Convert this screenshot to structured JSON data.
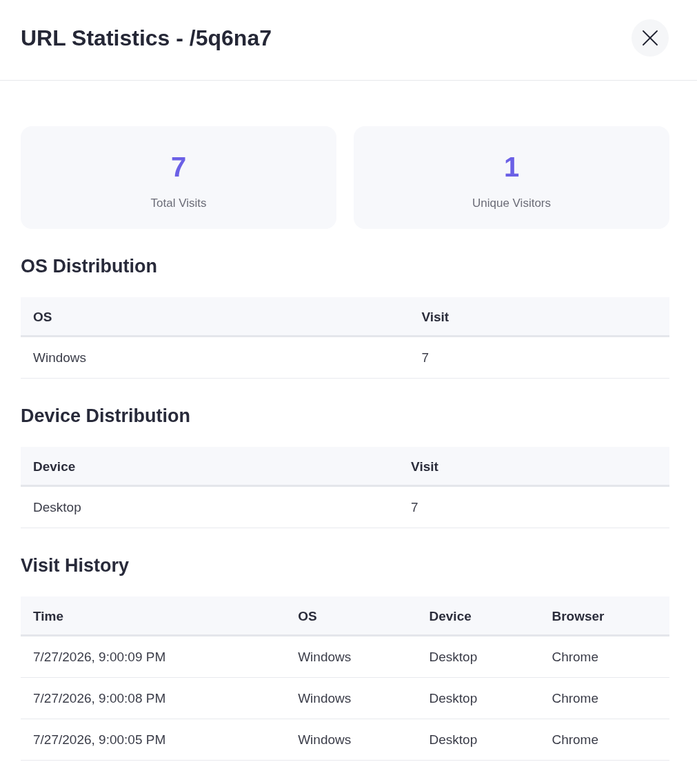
{
  "dialog": {
    "title": "URL Statistics - /5q6na7"
  },
  "stats": [
    {
      "value": "7",
      "label": "Total Visits"
    },
    {
      "value": "1",
      "label": "Unique Visitors"
    }
  ],
  "sections": [
    {
      "heading": "OS Distribution",
      "table": {
        "columns": [
          "OS",
          "Visit"
        ],
        "rows": [
          [
            "Windows",
            "7"
          ]
        ]
      }
    },
    {
      "heading": "Device Distribution",
      "table": {
        "columns": [
          "Device",
          "Visit"
        ],
        "rows": [
          [
            "Desktop",
            "7"
          ]
        ]
      }
    },
    {
      "heading": "Visit History",
      "table": {
        "columns": [
          "Time",
          "OS",
          "Device",
          "Browser"
        ],
        "rows": [
          [
            "7/27/2026, 9:00:09 PM",
            "Windows",
            "Desktop",
            "Chrome"
          ],
          [
            "7/27/2026, 9:00:08 PM",
            "Windows",
            "Desktop",
            "Chrome"
          ],
          [
            "7/27/2026, 9:00:05 PM",
            "Windows",
            "Desktop",
            "Chrome"
          ]
        ]
      }
    }
  ]
}
